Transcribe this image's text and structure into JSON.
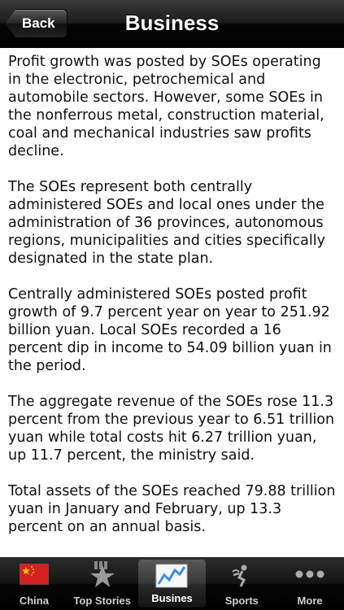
{
  "navbar": {
    "back_label": "Back",
    "title": "Business"
  },
  "article": {
    "paragraphs": [
      "Profit growth was posted by SOEs operating in the electronic, petrochemical and automobile sectors. However, some SOEs in the nonferrous metal, construction material, coal and mechanical industries saw profits decline.",
      "The SOEs represent both centrally administered SOEs and local ones under the administration of 36 provinces, autonomous regions, municipalities and cities specifically designated in the state plan.",
      "Centrally administered SOEs posted profit growth of 9.7 percent year on year to 251.92 billion yuan. Local SOEs recorded a 16 percent dip in income to 54.09 billion yuan in the period.",
      "The aggregate revenue of the SOEs rose 11.3 percent from the previous year to 6.51 trillion yuan while total costs hit 6.27 trillion yuan, up 11.7 percent, the ministry said.",
      "Total assets of the SOEs reached 79.88 trillion yuan in January and February, up 13.3 percent on an annual basis."
    ]
  },
  "tabbar": {
    "tabs": [
      {
        "label": "China",
        "icon": "china-flag-icon"
      },
      {
        "label": "Top Stories",
        "icon": "star-icon"
      },
      {
        "label": "Busines",
        "icon": "chart-icon",
        "selected": true
      },
      {
        "label": "Sports",
        "icon": "sports-icon"
      },
      {
        "label": "More",
        "icon": "more-icon"
      }
    ]
  },
  "colors": {
    "navbar": "#1c1c1c",
    "tabbar": "#141414",
    "flag_red": "#d42020",
    "chart_blue": "#3a8ee6"
  }
}
